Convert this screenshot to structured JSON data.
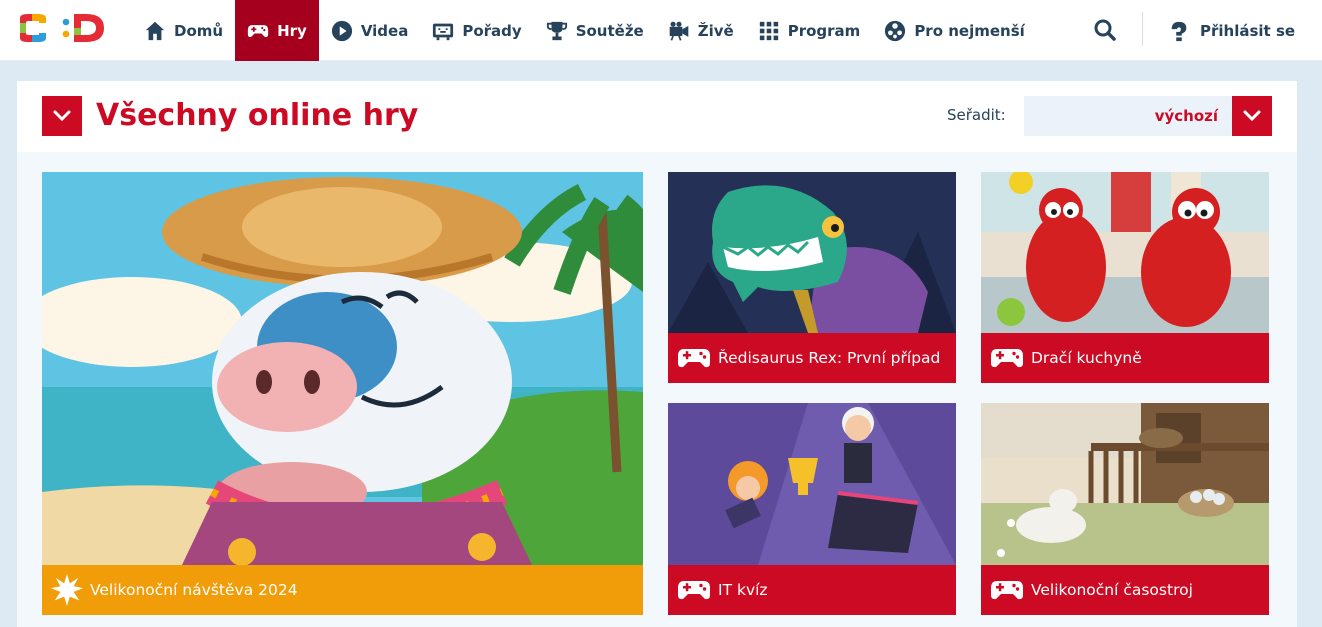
{
  "header": {
    "logo_alt": "ČT :D",
    "nav": [
      {
        "label": "Domů",
        "icon": "home-icon",
        "active": false
      },
      {
        "label": "Hry",
        "icon": "gamepad-icon",
        "active": true
      },
      {
        "label": "Videa",
        "icon": "play-icon",
        "active": false
      },
      {
        "label": "Pořady",
        "icon": "tv-icon",
        "active": false
      },
      {
        "label": "Soutěže",
        "icon": "trophy-icon",
        "active": false
      },
      {
        "label": "Živě",
        "icon": "camera-icon",
        "active": false
      },
      {
        "label": "Program",
        "icon": "grid-icon",
        "active": false
      },
      {
        "label": "Pro nejmenší",
        "icon": "baby-icon",
        "active": false
      }
    ],
    "search_icon": "search-icon",
    "login_label": "Přihlásit se"
  },
  "main": {
    "title": "Všechny online hry",
    "sort_label": "Seřadit:",
    "sort_value": "výchozí"
  },
  "cards": [
    {
      "title": "Velikonoční návštěva 2024",
      "icon": "starburst-icon",
      "featured": true
    },
    {
      "title": "Ředisaurus Rex: První případ",
      "icon": "gamepad-icon"
    },
    {
      "title": "Dračí kuchyně",
      "icon": "gamepad-icon"
    },
    {
      "title": "IT kvíz",
      "icon": "gamepad-icon"
    },
    {
      "title": "Velikonoční časostroj",
      "icon": "gamepad-icon"
    }
  ],
  "colors": {
    "brand_red": "#cc0a24",
    "active_nav": "#a5001e",
    "featured_orange": "#f09d09",
    "nav_text": "#27425b",
    "page_bg": "#dde9f3"
  }
}
